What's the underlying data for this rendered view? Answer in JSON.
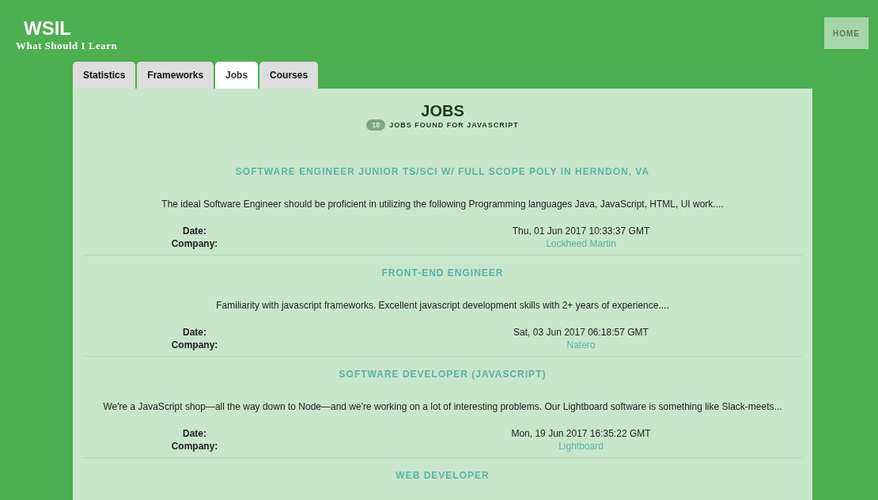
{
  "brand": {
    "title": "WSIL",
    "subtitle": "What Should I Learn"
  },
  "nav": {
    "home": "HOME"
  },
  "tabs": [
    {
      "label": "Statistics",
      "selected": false
    },
    {
      "label": "Frameworks",
      "selected": false
    },
    {
      "label": "Jobs",
      "selected": true
    },
    {
      "label": "Courses",
      "selected": false
    }
  ],
  "heading": {
    "title": "JOBS",
    "count": "18",
    "subtitle": "JOBS FOUND FOR JAVASCRIPT"
  },
  "jobs": [
    {
      "title": "SOFTWARE ENGINEER JUNIOR TS/SCI W/ FULL SCOPE POLY IN HERNDON, VA",
      "description": "The ideal Software Engineer should be proficient in utilizing the following Programming languages Java, JavaScript, HTML, UI work....",
      "date_label": "Date:",
      "date": "Thu, 01 Jun 2017 10:33:37 GMT",
      "company_label": "Company:",
      "company": "Lockheed Martin"
    },
    {
      "title": "FRONT-END ENGINEER",
      "description": "Familiarity with javascript frameworks. Excellent javascript development skills with 2+ years of experience....",
      "date_label": "Date:",
      "date": "Sat, 03 Jun 2017 06:18:57 GMT",
      "company_label": "Company:",
      "company": "Natero"
    },
    {
      "title": "SOFTWARE DEVELOPER (JAVASCRIPT)",
      "description": "We're a JavaScript shop—all the way down to Node—and we're working on a lot of interesting problems. Our Lightboard software is something like Slack-meets...",
      "date_label": "Date:",
      "date": "Mon, 19 Jun 2017 16:35:22 GMT",
      "company_label": "Company:",
      "company": "Lightboard"
    },
    {
      "title": "WEB DEVELOPER"
    }
  ]
}
